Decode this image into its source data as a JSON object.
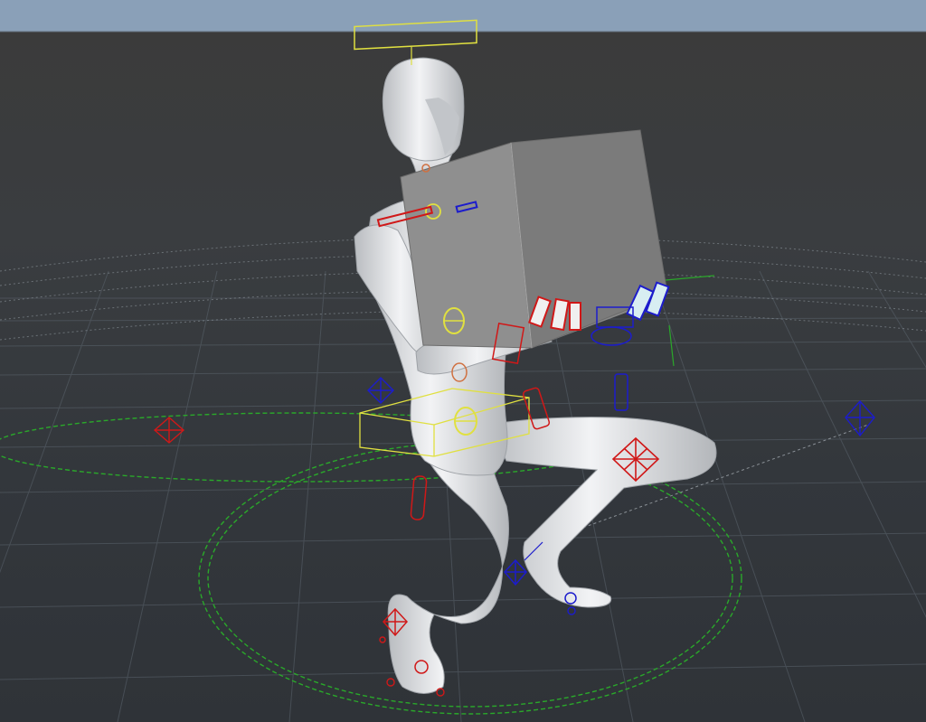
{
  "viewport": {
    "sky_color": "#8aa0b8",
    "background_color": "#3b3b3b",
    "grid_color": "#5a636c",
    "model_color": "#e4e6e9",
    "box_color": "#8a8a8a"
  },
  "controls": {
    "colors": {
      "fk_left": "#d01818",
      "fk_right": "#1c1ccc",
      "center": "#e0e040",
      "ground_circle": "#2aa82a",
      "orange": "#d07040"
    },
    "icons": [
      "octahedron-control-icon",
      "circle-control-icon",
      "box-control-icon"
    ]
  }
}
